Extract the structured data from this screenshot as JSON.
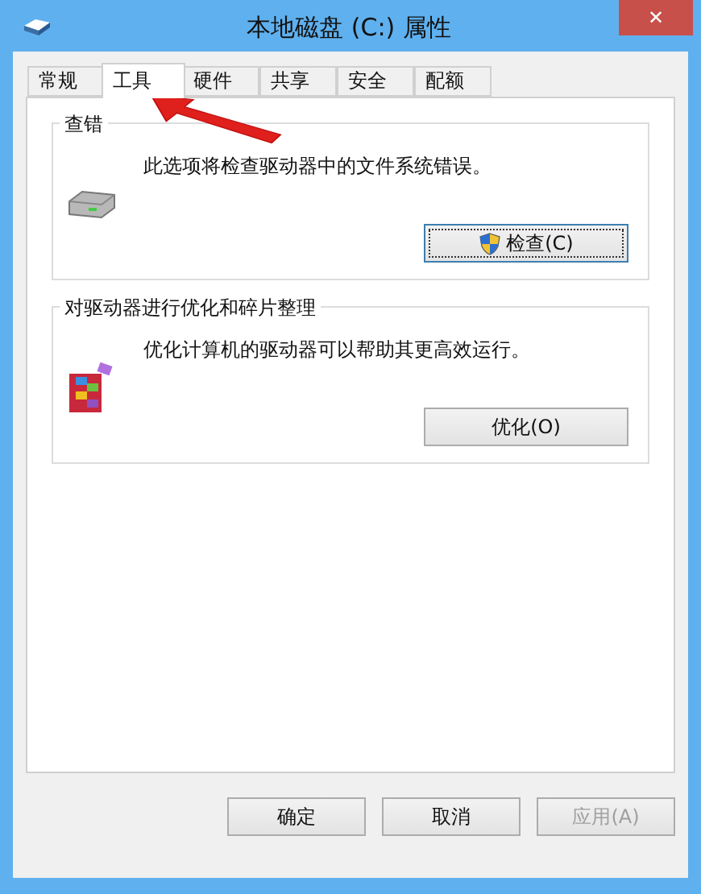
{
  "window": {
    "title": "本地磁盘 (C:) 属性",
    "close": "✕"
  },
  "tabs": [
    {
      "label": "常规",
      "selected": false
    },
    {
      "label": "工具",
      "selected": true
    },
    {
      "label": "硬件",
      "selected": false
    },
    {
      "label": "共享",
      "selected": false
    },
    {
      "label": "安全",
      "selected": false
    },
    {
      "label": "配额",
      "selected": false
    }
  ],
  "groups": [
    {
      "kind": "check",
      "title": "查错",
      "description": "此选项将检查驱动器中的文件系统错误。",
      "button": "检查(C)",
      "button_shield": true,
      "focused": true
    },
    {
      "kind": "optimize",
      "title": "对驱动器进行优化和碎片整理",
      "description": "优化计算机的驱动器可以帮助其更高效运行。",
      "button": "优化(O)",
      "button_shield": false,
      "focused": false
    }
  ],
  "buttons": [
    {
      "label": "确定",
      "disabled": false
    },
    {
      "label": "取消",
      "disabled": false
    },
    {
      "label": "应用(A)",
      "disabled": true
    }
  ],
  "annotation": {
    "kind": "arrow"
  }
}
